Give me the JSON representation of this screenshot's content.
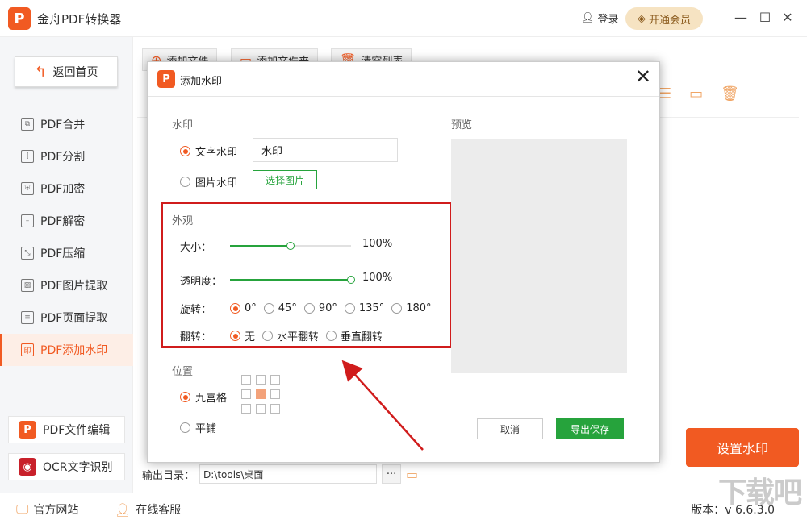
{
  "app": {
    "title": "金舟PDF转换器",
    "logo_letter": "P",
    "login": "登录",
    "vip": "开通会员"
  },
  "window": {
    "minimize": "—",
    "maximize": "☐",
    "close": "✕"
  },
  "sidebar": {
    "home": "返回首页",
    "items": [
      {
        "label": "PDF合并",
        "icon": "merge-icon",
        "glyph": "⧉"
      },
      {
        "label": "PDF分割",
        "icon": "split-icon",
        "glyph": "⫿"
      },
      {
        "label": "PDF加密",
        "icon": "lock-shield-icon",
        "glyph": "⛨"
      },
      {
        "label": "PDF解密",
        "icon": "unlock-shield-icon",
        "glyph": "–"
      },
      {
        "label": "PDF压缩",
        "icon": "compress-icon",
        "glyph": "⤡"
      },
      {
        "label": "PDF图片提取",
        "icon": "image-icon",
        "glyph": "▨"
      },
      {
        "label": "PDF页面提取",
        "icon": "page-icon",
        "glyph": "≡"
      },
      {
        "label": "PDF添加水印",
        "icon": "watermark-icon",
        "glyph": "印"
      }
    ],
    "editor": "PDF文件编辑",
    "ocr": "OCR文字识别"
  },
  "toolbar": {
    "add_file": "添加文件",
    "add_folder": "添加文件夹",
    "clear_list": "清空列表"
  },
  "output": {
    "label": "输出目录：",
    "path": "D:\\tools\\桌面",
    "dots": "···"
  },
  "set_watermark": "设置水印",
  "footer": {
    "website": "官方网站",
    "support": "在线客服",
    "version": "版本：v 6.6.3.0"
  },
  "brand_watermark": "下载吧",
  "dialog": {
    "title": "添加水印",
    "watermark_section": "水印",
    "text_watermark": "文字水印",
    "text_value": "水印",
    "image_watermark": "图片水印",
    "choose_image": "选择图片",
    "appearance_section": "外观",
    "size_label": "大小：",
    "size_value": "100%",
    "size_level": 0.5,
    "opacity_label": "透明度：",
    "opacity_value": "100%",
    "opacity_level": 1.0,
    "rotate_label": "旋转：",
    "rotate_options": [
      "0°",
      "45°",
      "90°",
      "135°",
      "180°"
    ],
    "rotate_selected": 0,
    "flip_label": "翻转：",
    "flip_options": [
      "无",
      "水平翻转",
      "垂直翻转"
    ],
    "flip_selected": 0,
    "position_section": "位置",
    "grid_option": "九宫格",
    "tile_option": "平铺",
    "grid_selected_cell": 4,
    "preview_label": "预览",
    "cancel": "取消",
    "save": "导出保存"
  },
  "colors": {
    "accent": "#f15a22",
    "green": "#26a33c",
    "highlight": "#d01c1c"
  }
}
